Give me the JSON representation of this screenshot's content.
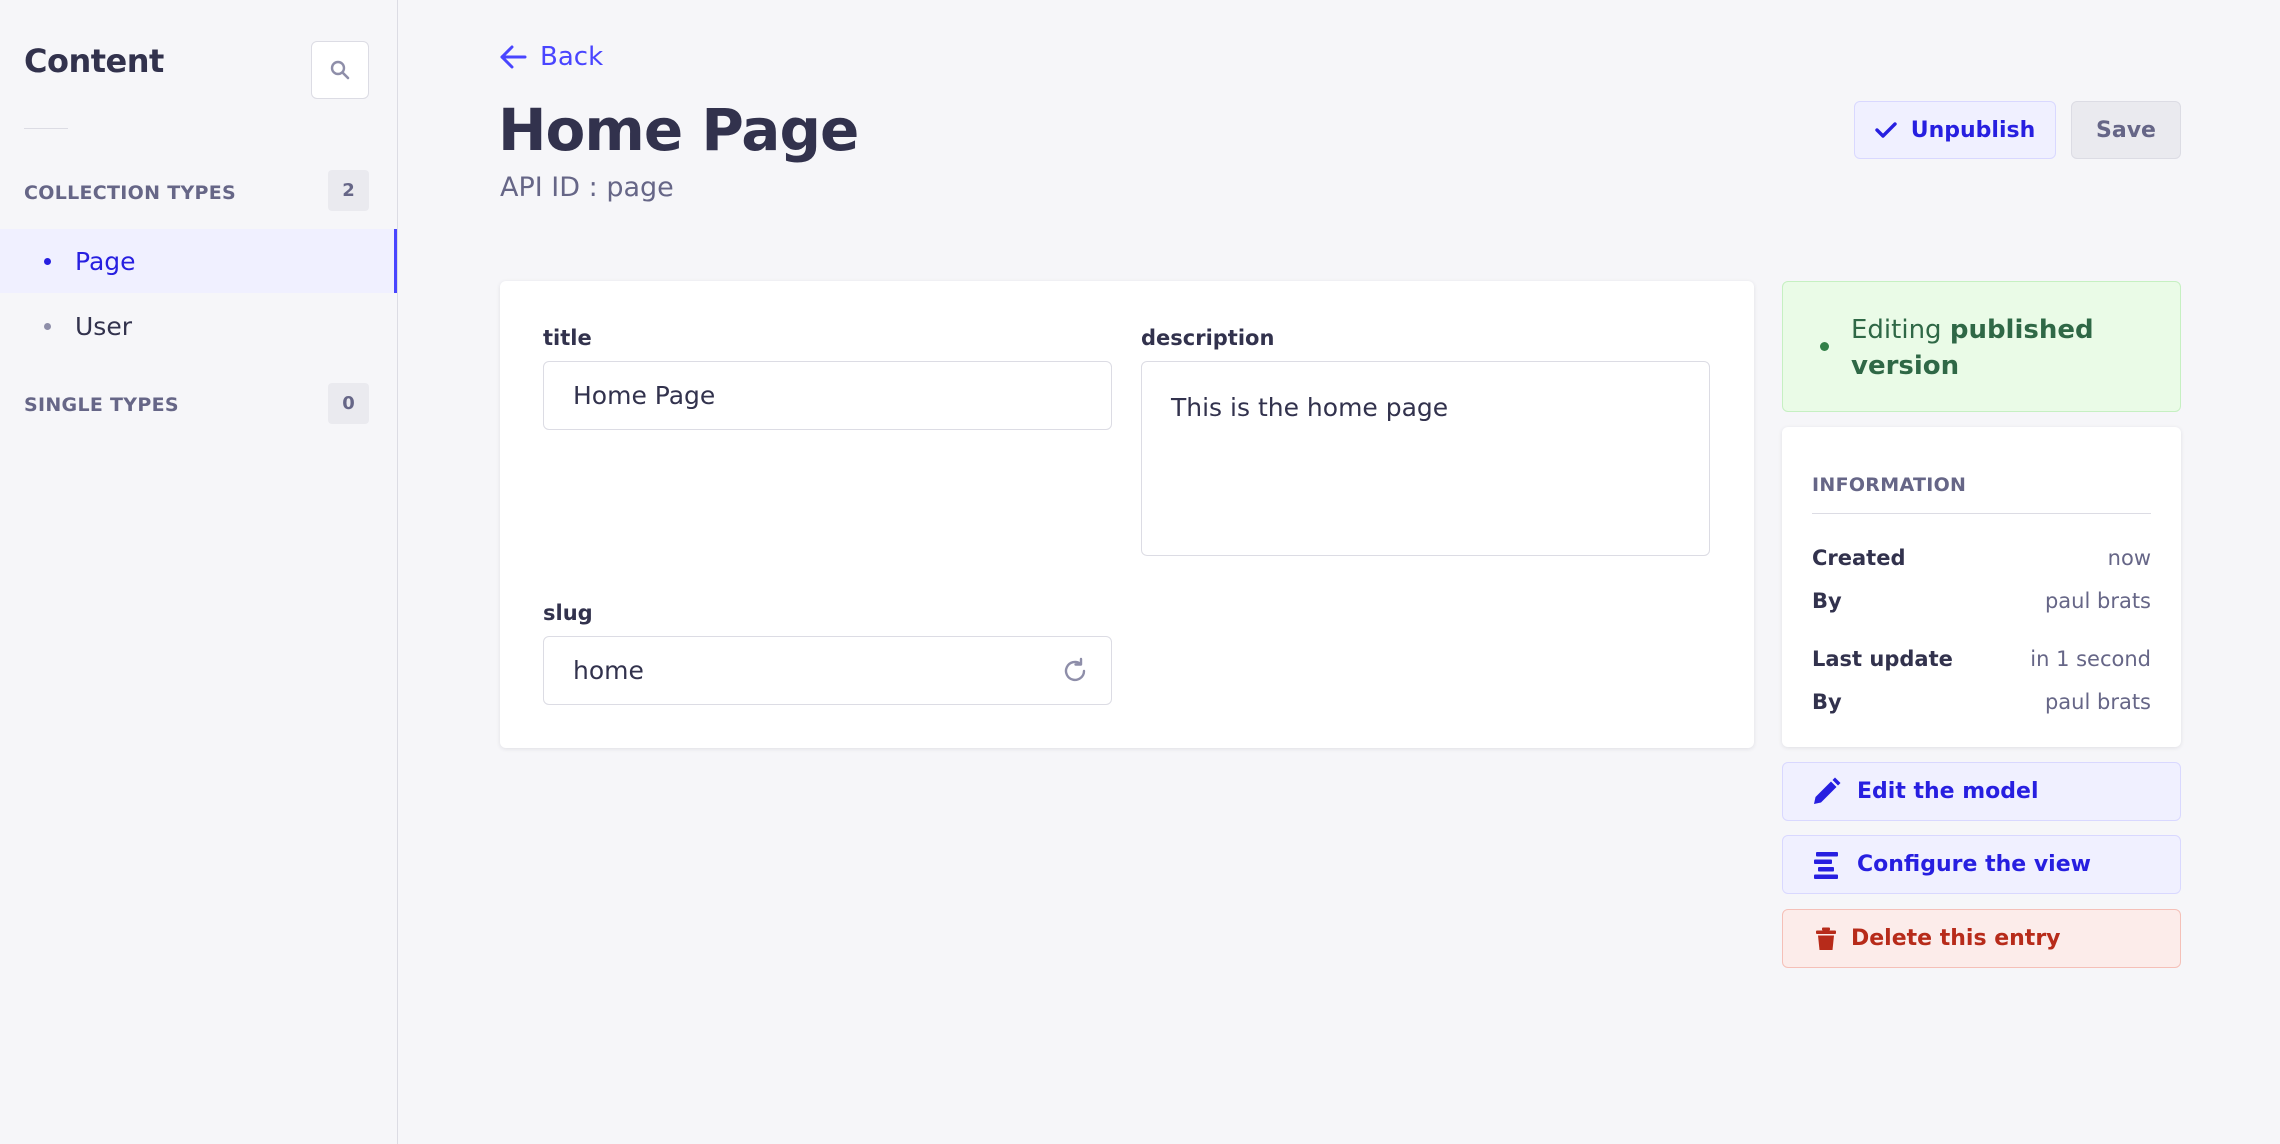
{
  "sidebar": {
    "title": "Content",
    "sections": [
      {
        "label": "COLLECTION TYPES",
        "count": "2",
        "items": [
          {
            "label": "Page",
            "active": true
          },
          {
            "label": "User",
            "active": false
          }
        ]
      },
      {
        "label": "SINGLE TYPES",
        "count": "0",
        "items": []
      }
    ]
  },
  "header": {
    "back_label": "Back",
    "title": "Home Page",
    "api_id": "API ID : page",
    "unpublish_label": "Unpublish",
    "save_label": "Save"
  },
  "form": {
    "fields": {
      "title": {
        "label": "title",
        "value": "Home Page"
      },
      "description": {
        "label": "description",
        "value": "This is the home page"
      },
      "slug": {
        "label": "slug",
        "value": "home"
      }
    }
  },
  "status": {
    "prefix": "Editing",
    "emphasis": "published version"
  },
  "information": {
    "title": "INFORMATION",
    "rows": [
      {
        "key": "Created",
        "value": "now"
      },
      {
        "key": "By",
        "value": "paul brats"
      },
      {
        "key": "Last update",
        "value": "in 1 second"
      },
      {
        "key": "By",
        "value": "paul brats"
      }
    ]
  },
  "actions": {
    "edit_model": "Edit the model",
    "configure_view": "Configure the view",
    "delete_entry": "Delete this entry"
  },
  "colors": {
    "primary": "#4945ff",
    "primary_dark": "#271fe0",
    "success": "#328048",
    "danger": "#b72b1a",
    "neutral_bg": "#f6f6f9"
  }
}
